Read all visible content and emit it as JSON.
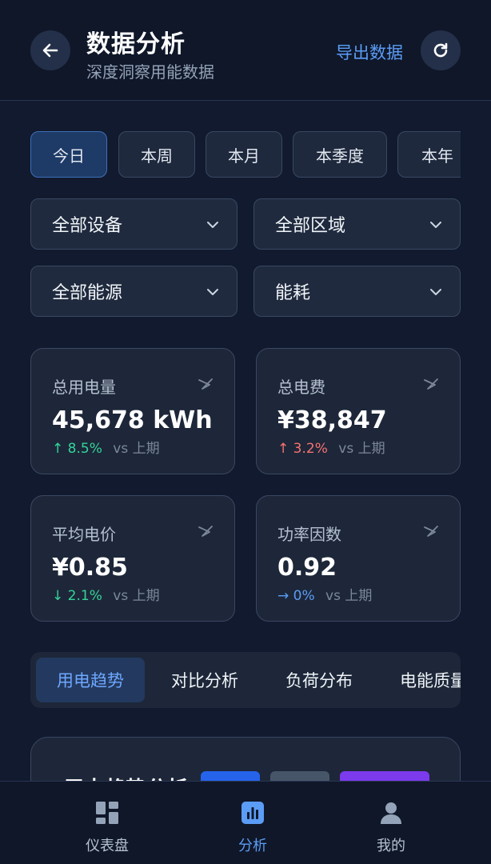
{
  "header": {
    "title": "数据分析",
    "subtitle": "深度洞察用能数据",
    "export_label": "导出数据"
  },
  "period_chips": [
    {
      "label": "今日",
      "active": true
    },
    {
      "label": "本周",
      "active": false
    },
    {
      "label": "本月",
      "active": false
    },
    {
      "label": "本季度",
      "active": false
    },
    {
      "label": "本年",
      "active": false
    }
  ],
  "filters": {
    "device": "全部设备",
    "area": "全部区域",
    "energy": "全部能源",
    "metric": "能耗"
  },
  "kpis": [
    {
      "label": "总用电量",
      "value": "45,678 kWh",
      "arrow": "↑",
      "delta": "8.5%",
      "vs": "vs 上期",
      "tone": "up-green"
    },
    {
      "label": "总电费",
      "value": "¥38,847",
      "arrow": "↑",
      "delta": "3.2%",
      "vs": "vs 上期",
      "tone": "up-red"
    },
    {
      "label": "平均电价",
      "value": "¥0.85",
      "arrow": "↓",
      "delta": "2.1%",
      "vs": "vs 上期",
      "tone": "down-green"
    },
    {
      "label": "功率因数",
      "value": "0.92",
      "arrow": "→",
      "delta": "0%",
      "vs": "vs 上期",
      "tone": "flat-blue"
    }
  ],
  "tabs": [
    {
      "label": "用电趋势",
      "active": true
    },
    {
      "label": "对比分析",
      "active": false
    },
    {
      "label": "负荷分布",
      "active": false
    },
    {
      "label": "电能质量",
      "active": false
    }
  ],
  "panel": {
    "title": "用电趋势分析"
  },
  "colors": {
    "accent": "#5b9cf5",
    "bg": "#111a2e",
    "pill_blue": "#2563eb",
    "pill_gray": "#475569",
    "pill_purple": "#7c3aed"
  },
  "bottom_nav": [
    {
      "label": "仪表盘",
      "icon": "dashboard-icon",
      "active": false
    },
    {
      "label": "分析",
      "icon": "chart-icon",
      "active": true
    },
    {
      "label": "我的",
      "icon": "user-icon",
      "active": false
    }
  ]
}
